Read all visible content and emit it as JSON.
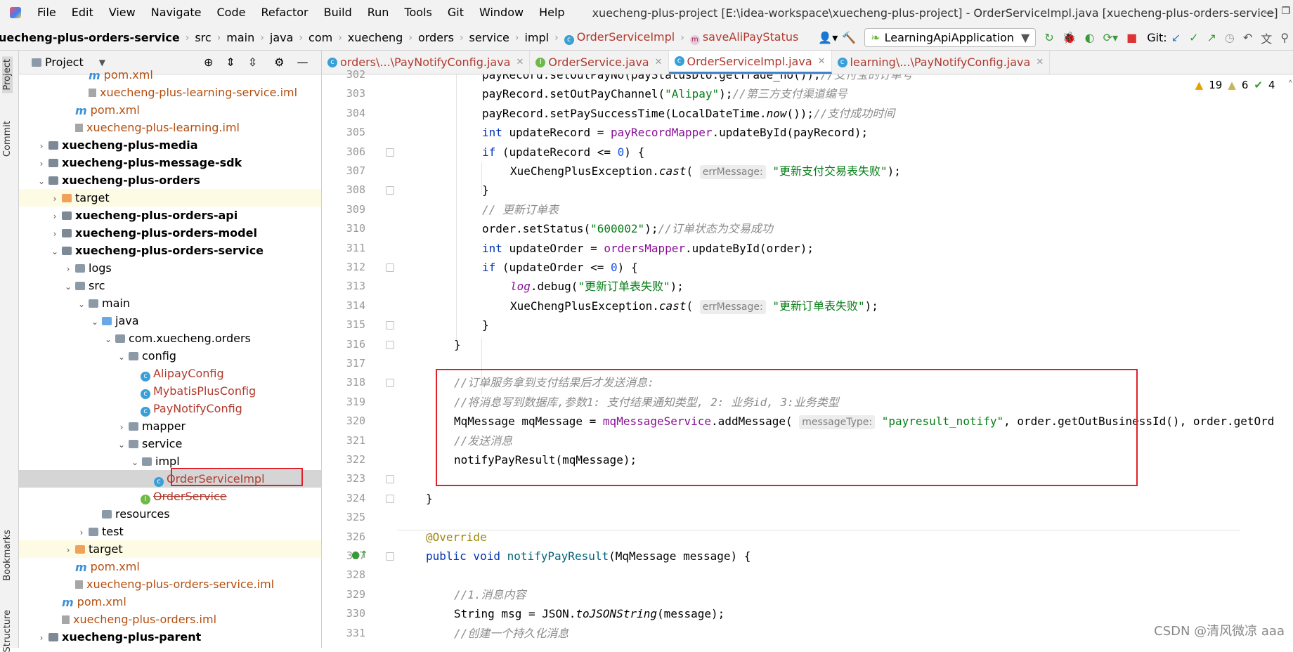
{
  "menu": [
    "File",
    "Edit",
    "View",
    "Navigate",
    "Code",
    "Refactor",
    "Build",
    "Run",
    "Tools",
    "Git",
    "Window",
    "Help"
  ],
  "window_title": "xuecheng-plus-project [E:\\idea-workspace\\xuecheng-plus-project] - OrderServiceImpl.java [xuecheng-plus-orders-service]",
  "breadcrumb": [
    "uecheng-plus-orders-service",
    "src",
    "main",
    "java",
    "com",
    "xuecheng",
    "orders",
    "service",
    "impl",
    "OrderServiceImpl",
    "saveAliPayStatus"
  ],
  "run_config": "LearningApiApplication",
  "git_label": "Git:",
  "project": {
    "title": "Project",
    "tree": [
      {
        "label": "pom.xml",
        "indent": 5,
        "icon": "mvn",
        "style": "orange"
      },
      {
        "label": "xuecheng-plus-learning-service.iml",
        "indent": 5,
        "icon": "file",
        "style": "orange"
      },
      {
        "label": "pom.xml",
        "indent": 4,
        "icon": "mvn",
        "style": "orange"
      },
      {
        "label": "xuecheng-plus-learning.iml",
        "indent": 4,
        "icon": "file",
        "style": "orange"
      },
      {
        "label": "xuecheng-plus-media",
        "indent": 2,
        "icon": "mod",
        "arrow": "›",
        "style": "bold"
      },
      {
        "label": "xuecheng-plus-message-sdk",
        "indent": 2,
        "icon": "mod",
        "arrow": "›",
        "style": "bold"
      },
      {
        "label": "xuecheng-plus-orders",
        "indent": 2,
        "icon": "mod",
        "arrow": "⌄",
        "style": "bold"
      },
      {
        "label": "target",
        "indent": 3,
        "icon": "folder-orange",
        "arrow": "›",
        "style": "",
        "hl": true
      },
      {
        "label": "xuecheng-plus-orders-api",
        "indent": 3,
        "icon": "mod",
        "arrow": "›",
        "style": "bold"
      },
      {
        "label": "xuecheng-plus-orders-model",
        "indent": 3,
        "icon": "mod",
        "arrow": "›",
        "style": "bold"
      },
      {
        "label": "xuecheng-plus-orders-service",
        "indent": 3,
        "icon": "mod",
        "arrow": "⌄",
        "style": "bold"
      },
      {
        "label": "logs",
        "indent": 4,
        "icon": "folder",
        "arrow": "›",
        "style": ""
      },
      {
        "label": "src",
        "indent": 4,
        "icon": "folder",
        "arrow": "⌄",
        "style": ""
      },
      {
        "label": "main",
        "indent": 5,
        "icon": "folder",
        "arrow": "⌄",
        "style": ""
      },
      {
        "label": "java",
        "indent": 6,
        "icon": "folder-blue",
        "arrow": "⌄",
        "style": ""
      },
      {
        "label": "com.xuecheng.orders",
        "indent": 7,
        "icon": "folder",
        "arrow": "⌄",
        "style": ""
      },
      {
        "label": "config",
        "indent": 8,
        "icon": "folder",
        "arrow": "⌄",
        "style": ""
      },
      {
        "label": "AlipayConfig",
        "indent": 9,
        "icon": "cls",
        "style": "red"
      },
      {
        "label": "MybatisPlusConfig",
        "indent": 9,
        "icon": "cls",
        "style": "red"
      },
      {
        "label": "PayNotifyConfig",
        "indent": 9,
        "icon": "cls",
        "style": "red"
      },
      {
        "label": "mapper",
        "indent": 8,
        "icon": "folder",
        "arrow": "›",
        "style": ""
      },
      {
        "label": "service",
        "indent": 8,
        "icon": "folder",
        "arrow": "⌄",
        "style": ""
      },
      {
        "label": "impl",
        "indent": 9,
        "icon": "folder",
        "arrow": "⌄",
        "style": ""
      },
      {
        "label": "OrderServiceImpl",
        "indent": 10,
        "icon": "cls",
        "style": "red",
        "sel": true
      },
      {
        "label": "OrderService",
        "indent": 9,
        "icon": "int",
        "style": "strike"
      },
      {
        "label": "resources",
        "indent": 6,
        "icon": "folder",
        "style": ""
      },
      {
        "label": "test",
        "indent": 5,
        "icon": "folder",
        "arrow": "›",
        "style": ""
      },
      {
        "label": "target",
        "indent": 4,
        "icon": "folder-orange",
        "arrow": "›",
        "style": "",
        "hl": true
      },
      {
        "label": "pom.xml",
        "indent": 4,
        "icon": "mvn",
        "style": "orange"
      },
      {
        "label": "xuecheng-plus-orders-service.iml",
        "indent": 4,
        "icon": "file",
        "style": "orange"
      },
      {
        "label": "pom.xml",
        "indent": 3,
        "icon": "mvn",
        "style": "orange"
      },
      {
        "label": "xuecheng-plus-orders.iml",
        "indent": 3,
        "icon": "file",
        "style": "orange"
      },
      {
        "label": "xuecheng-plus-parent",
        "indent": 2,
        "icon": "mod",
        "arrow": "›",
        "style": "bold"
      }
    ]
  },
  "side_labels": [
    "Project",
    "Commit",
    "Bookmarks",
    "Structure"
  ],
  "tabs": [
    {
      "label": "orders\\...\\PayNotifyConfig.java",
      "icon": "cls",
      "active": false
    },
    {
      "label": "OrderService.java",
      "icon": "int",
      "active": false
    },
    {
      "label": "OrderServiceImpl.java",
      "icon": "cls",
      "active": true
    },
    {
      "label": "learning\\...\\PayNotifyConfig.java",
      "icon": "cls",
      "active": false
    }
  ],
  "inspections": {
    "warnings": "19",
    "weak": "6",
    "ok": "4"
  },
  "code_lines": [
    {
      "n": "302",
      "indent": 2,
      "html": "payRecord.setOutPayNo(payStatusDto.getTrade_no());<span class=\"cmt\">//支付宝的订单号</span>"
    },
    {
      "n": "303",
      "indent": 2,
      "html": "payRecord.setOutPayChannel(<span class=\"str\">\"Alipay\"</span>);<span class=\"cmt\">//第三方支付渠道编号</span>"
    },
    {
      "n": "304",
      "indent": 2,
      "html": "payRecord.setPaySuccessTime(LocalDateTime.<span class=\"it\">now</span>());<span class=\"cmt\">//支付成功时间</span>"
    },
    {
      "n": "305",
      "indent": 2,
      "html": "<span class=\"kw\">int</span> updateRecord = <span class=\"fld\">payRecordMapper</span>.updateById(payRecord);"
    },
    {
      "n": "306",
      "indent": 2,
      "html": "<span class=\"kw\">if</span> (updateRecord &lt;= <span class=\"num\">0</span>) {"
    },
    {
      "n": "307",
      "indent": 3,
      "html": "XueChengPlusException.<span class=\"it\">cast</span>( <span class=\"hint\">errMessage:</span> <span class=\"str\">\"更新支付交易表失败\"</span>);"
    },
    {
      "n": "308",
      "indent": 2,
      "html": "}"
    },
    {
      "n": "309",
      "indent": 2,
      "html": "<span class=\"cmt\">// 更新订单表</span>"
    },
    {
      "n": "310",
      "indent": 2,
      "html": "order.setStatus(<span class=\"str\">\"600002\"</span>);<span class=\"cmt\">//订单状态为交易成功</span>"
    },
    {
      "n": "311",
      "indent": 2,
      "html": "<span class=\"kw\">int</span> updateOrder = <span class=\"fld\">ordersMapper</span>.updateById(order);"
    },
    {
      "n": "312",
      "indent": 2,
      "html": "<span class=\"kw\">if</span> (updateOrder &lt;= <span class=\"num\">0</span>) {"
    },
    {
      "n": "313",
      "indent": 3,
      "html": "<span class=\"fld it\">log</span>.debug(<span class=\"str\">\"更新订单表失败\"</span>);"
    },
    {
      "n": "314",
      "indent": 3,
      "html": "XueChengPlusException.<span class=\"it\">cast</span>( <span class=\"hint\">errMessage:</span> <span class=\"str\">\"更新订单表失败\"</span>);"
    },
    {
      "n": "315",
      "indent": 2,
      "html": "}"
    },
    {
      "n": "316",
      "indent": 1,
      "html": "}"
    },
    {
      "n": "317",
      "indent": 0,
      "html": ""
    },
    {
      "n": "318",
      "indent": 1,
      "html": "<span class=\"cmt\">//订单服务拿到支付结果后才发送消息:</span>"
    },
    {
      "n": "319",
      "indent": 1,
      "html": "<span class=\"cmt\">//将消息写到数据库,参数1: 支付结果通知类型, 2: 业务id, 3:业务类型</span>"
    },
    {
      "n": "320",
      "indent": 1,
      "html": "MqMessage mqMessage = <span class=\"fld\">mqMessageService</span>.addMessage( <span class=\"hint\">messageType:</span> <span class=\"str\">\"payresult_notify\"</span>, order.getOutBusinessId(), order.getOrd"
    },
    {
      "n": "321",
      "indent": 1,
      "html": "<span class=\"cmt\">//发送消息</span>"
    },
    {
      "n": "322",
      "indent": 1,
      "html": "notifyPayResult(mqMessage);"
    },
    {
      "n": "323",
      "indent": 0,
      "html": ""
    },
    {
      "n": "324",
      "indent": 0,
      "html": "}"
    },
    {
      "n": "325",
      "indent": 0,
      "html": ""
    },
    {
      "n": "326",
      "indent": 0,
      "html": "<span class=\"ann\">@Override</span>"
    },
    {
      "n": "327",
      "indent": 0,
      "html": "<span class=\"kw\">public void</span> <span class=\"fn\">notifyPayResult</span>(MqMessage message) {"
    },
    {
      "n": "328",
      "indent": 0,
      "html": ""
    },
    {
      "n": "329",
      "indent": 1,
      "html": "<span class=\"cmt\">//1.消息内容</span>"
    },
    {
      "n": "330",
      "indent": 1,
      "html": "String msg = JSON.<span class=\"it\">toJSONString</span>(message);"
    },
    {
      "n": "331",
      "indent": 1,
      "html": "<span class=\"cmt\">//创建一个持久化消息</span>"
    }
  ],
  "watermark": "CSDN @清风微凉 aaa"
}
